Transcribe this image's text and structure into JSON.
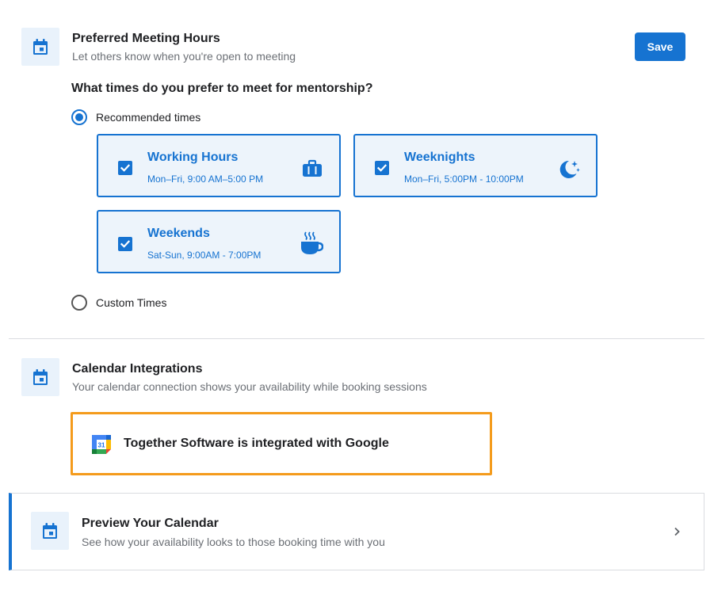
{
  "meeting_hours": {
    "icon": "calendar-icon",
    "title": "Preferred Meeting Hours",
    "subtitle": "Let others know when you're open to meeting",
    "save_label": "Save",
    "question": "What times do you prefer to meet for mentorship?",
    "recommended_label": "Recommended times",
    "recommended_selected": true,
    "options": [
      {
        "title": "Working Hours",
        "subtitle": "Mon–Fri, 9:00 AM–5:00 PM",
        "checked": true,
        "icon": "briefcase-icon"
      },
      {
        "title": "Weeknights",
        "subtitle": "Mon–Fri, 5:00PM - 10:00PM",
        "checked": true,
        "icon": "moon-stars-icon"
      },
      {
        "title": "Weekends",
        "subtitle": "Sat-Sun, 9:00AM - 7:00PM",
        "checked": true,
        "icon": "coffee-cup-icon"
      }
    ],
    "custom_label": "Custom Times",
    "custom_selected": false
  },
  "calendar_integrations": {
    "icon": "calendar-icon",
    "title": "Calendar Integrations",
    "subtitle": "Your calendar connection shows your availability while booking sessions",
    "google_icon_text": "31",
    "google_text": "Together Software is integrated with Google"
  },
  "preview": {
    "icon": "calendar-icon",
    "title": "Preview Your Calendar",
    "subtitle": "See how your availability looks to those booking time with you",
    "chevron": "chevron-right-icon"
  },
  "colors": {
    "accent": "#1673d1",
    "card_bg": "#edf4fb",
    "highlight": "#f49b1c",
    "muted_text": "#6b6f75"
  }
}
